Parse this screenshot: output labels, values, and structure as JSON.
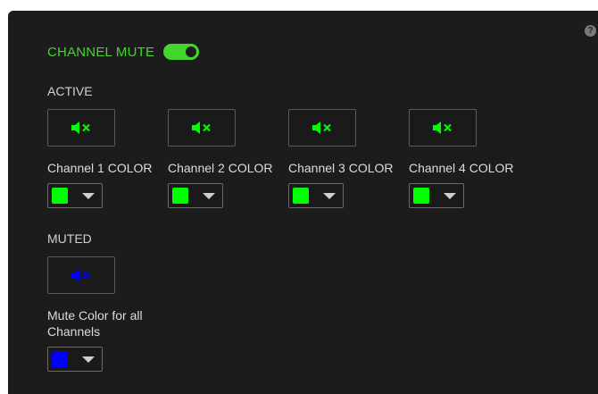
{
  "header": {
    "title": "CHANNEL MUTE",
    "toggle_on": true,
    "help_glyph": "?"
  },
  "colors": {
    "accent": "#44d62c",
    "active_channel": "#00ff00",
    "muted": "#0000ff",
    "panel_bg": "#1c1c1c"
  },
  "active": {
    "label": "ACTIVE",
    "channels": [
      {
        "label": "Channel 1 COLOR",
        "color": "#00ff00",
        "icon": "speaker-muted-icon"
      },
      {
        "label": "Channel 2 COLOR",
        "color": "#00ff00",
        "icon": "speaker-muted-icon"
      },
      {
        "label": "Channel 3 COLOR",
        "color": "#00ff00",
        "icon": "speaker-muted-icon"
      },
      {
        "label": "Channel 4 COLOR",
        "color": "#00ff00",
        "icon": "speaker-muted-icon"
      }
    ]
  },
  "muted": {
    "label": "MUTED",
    "color_label": "Mute Color for all Channels",
    "color": "#0000ff",
    "icon": "speaker-muted-icon"
  }
}
